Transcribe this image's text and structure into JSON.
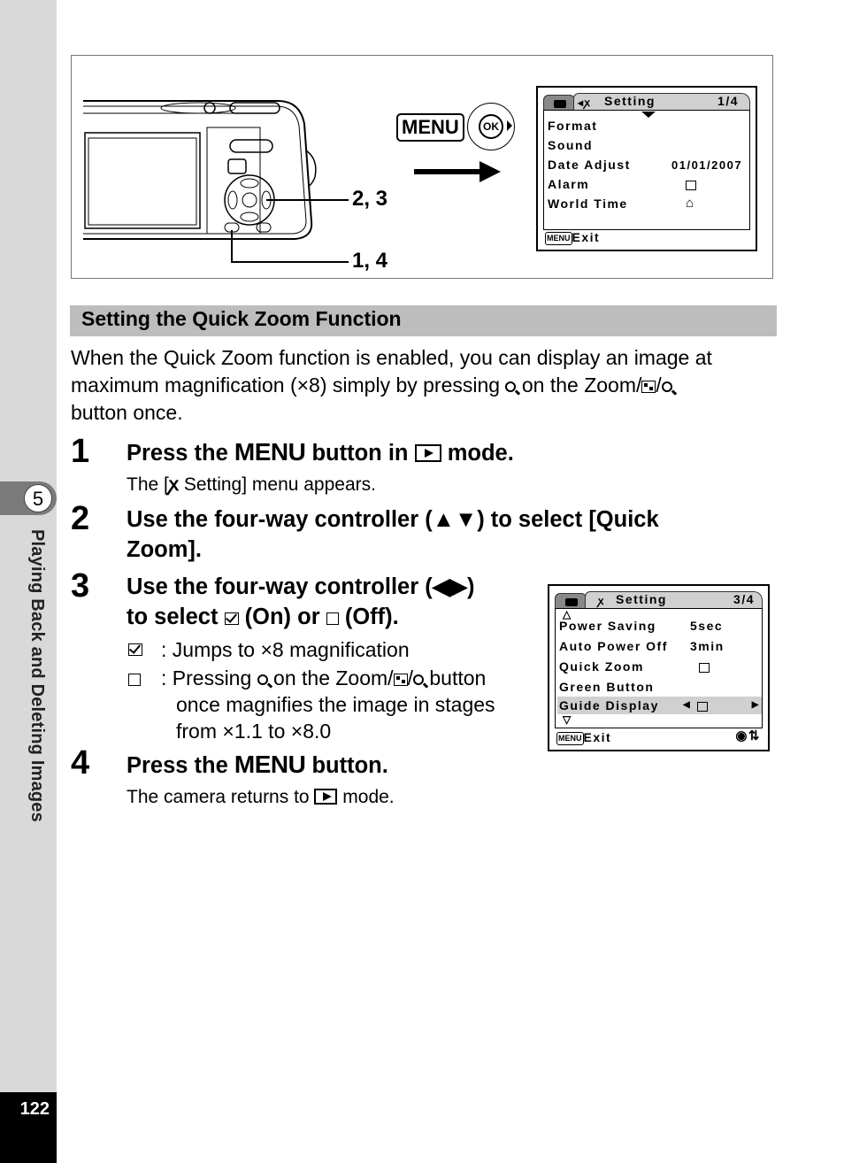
{
  "sidebar": {
    "chapter_number": "5",
    "chapter_title": "Playing Back and Deleting Images",
    "page_number": "122"
  },
  "figure": {
    "callout_a": "2, 3",
    "callout_b": "1, 4",
    "menu_key_label": "MENU",
    "ok_label": "OK",
    "screen1": {
      "tab_title": "Setting",
      "page": "1/4",
      "items": [
        {
          "label": "Format",
          "value": ""
        },
        {
          "label": "Sound",
          "value": ""
        },
        {
          "label": "Date Adjust",
          "value": "01/01/2007"
        },
        {
          "label": "Alarm",
          "value": "off-box-icon"
        },
        {
          "label": "World Time",
          "value": "home-icon"
        }
      ],
      "footer_key": "MENU",
      "footer_label": "Exit"
    },
    "screen2": {
      "tab_title": "Setting",
      "page": "3/4",
      "items": [
        {
          "label": "Power Saving",
          "value": "5sec"
        },
        {
          "label": "Auto Power Off",
          "value": "3min"
        },
        {
          "label": "Quick Zoom",
          "value": "off-box-icon"
        },
        {
          "label": "Green Button",
          "value": ""
        },
        {
          "label": "Guide Display",
          "value": "off-box-icon",
          "selected": true
        }
      ],
      "footer_key": "MENU",
      "footer_label": "Exit"
    }
  },
  "section": {
    "title": "Setting the Quick Zoom Function",
    "intro_1": "When the Quick Zoom function is enabled, you can display an image at maximum magnification (×8) simply by pressing",
    "intro_2": "on the Zoom/",
    "intro_3": "button once."
  },
  "steps": [
    {
      "num": "1",
      "pre": "Press the",
      "menu": "MENU",
      "post": "button in",
      "post2": "mode.",
      "sub_pre": "The [",
      "sub_post": "Setting] menu appears."
    },
    {
      "num": "2",
      "line1": "Use the four-way controller (▲▼) to select [Quick",
      "line2": "Zoom]."
    },
    {
      "num": "3",
      "line1": "Use the four-way controller (◀▶)",
      "line2_pre": "to select",
      "line2_on": "(On) or",
      "line2_off": "(Off).",
      "on_desc": ": Jumps to ×8 magnification",
      "off_desc_1": ": Pressing",
      "off_desc_2": "on the Zoom/",
      "off_desc_3": "button",
      "off_desc_4": "once magnifies the image in stages",
      "off_desc_5": "from ×1.1 to ×8.0"
    },
    {
      "num": "4",
      "pre": "Press the",
      "menu": "MENU",
      "post": "button.",
      "sub_pre": "The camera returns to",
      "sub_post": "mode."
    }
  ]
}
